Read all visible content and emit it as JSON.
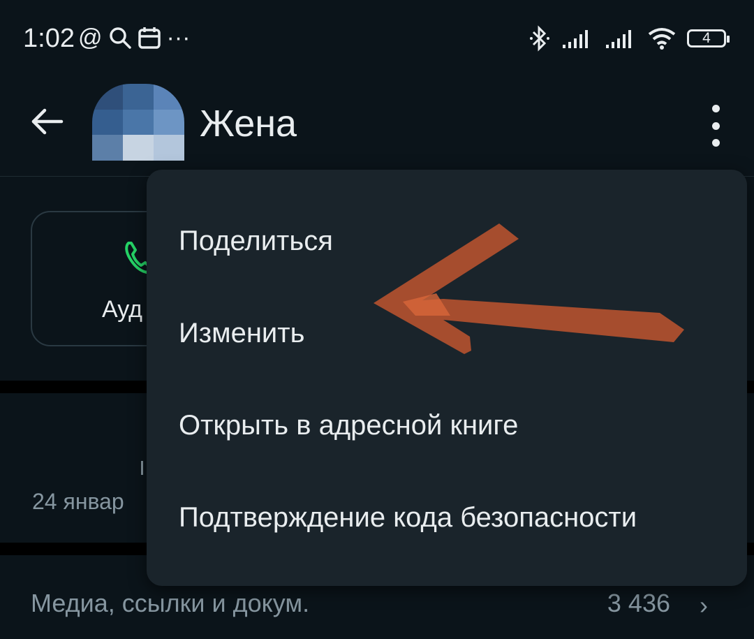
{
  "status_bar": {
    "time": "1:02",
    "left_icons": [
      "at-sign-icon",
      "search-icon",
      "calendar-icon",
      "more-notifications-icon"
    ],
    "right_icons": [
      "bluetooth-icon",
      "signal-icon",
      "signal-icon",
      "wifi-icon"
    ],
    "battery_level": "4"
  },
  "header": {
    "title": "Жена",
    "avatar_icon": "contact-avatar",
    "back_icon": "back-arrow-icon",
    "more_icon": "more-vertical-icon"
  },
  "action_card": {
    "label": "Ауд",
    "icon": "phone-icon",
    "icon_color": "#25d366"
  },
  "about": {
    "date_partial": "24 январ"
  },
  "media": {
    "label": "Медиа, ссылки и докум.",
    "count": "3 436",
    "chevron": "›"
  },
  "menu": {
    "items": [
      {
        "label": "Поделиться"
      },
      {
        "label": "Изменить"
      },
      {
        "label": "Открыть в адресной книге"
      },
      {
        "label": "Подтверждение кода безопасности"
      }
    ]
  },
  "annotation": {
    "color": "#c0552f"
  }
}
